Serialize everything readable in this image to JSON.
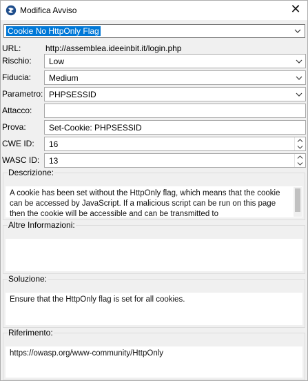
{
  "window": {
    "title": "Modifica Avviso",
    "close_glyph": "✕"
  },
  "alert": {
    "name": "Cookie No HttpOnly Flag"
  },
  "fields": {
    "url": {
      "label": "URL:",
      "value": "http://assemblea.ideeinbit.it/login.php"
    },
    "rischio": {
      "label": "Rischio:",
      "value": "Low"
    },
    "fiducia": {
      "label": "Fiducia:",
      "value": "Medium"
    },
    "parametro": {
      "label": "Parametro:",
      "value": "PHPSESSID"
    },
    "attacco": {
      "label": "Attacco:",
      "value": ""
    },
    "prova": {
      "label": "Prova:",
      "value": "Set-Cookie: PHPSESSID"
    },
    "cwe": {
      "label": "CWE ID:",
      "value": "16"
    },
    "wasc": {
      "label": "WASC ID:",
      "value": "13"
    }
  },
  "sections": {
    "descrizione": {
      "title": "Descrizione:",
      "text": "A cookie has been set without the HttpOnly flag, which means that the cookie can be accessed by JavaScript. If a malicious script can be run on this page then the cookie will be accessible and can be transmitted to"
    },
    "altre": {
      "title": "Altre Informazioni:",
      "text": ""
    },
    "soluzione": {
      "title": "Soluzione:",
      "text": "Ensure that the HttpOnly flag is set for all cookies."
    },
    "riferimento": {
      "title": "Riferimento:",
      "text": "https://owasp.org/www-community/HttpOnly"
    }
  },
  "icons": {
    "app": "zap-logo-icon",
    "close": "close-icon",
    "dropdown": "chevron-down-icon",
    "spin_up": "spin-up-icon",
    "spin_down": "spin-down-icon"
  },
  "colors": {
    "selection": "#0078d7",
    "window_bg": "#f0f0f0",
    "field_border": "#a8a8a8"
  }
}
